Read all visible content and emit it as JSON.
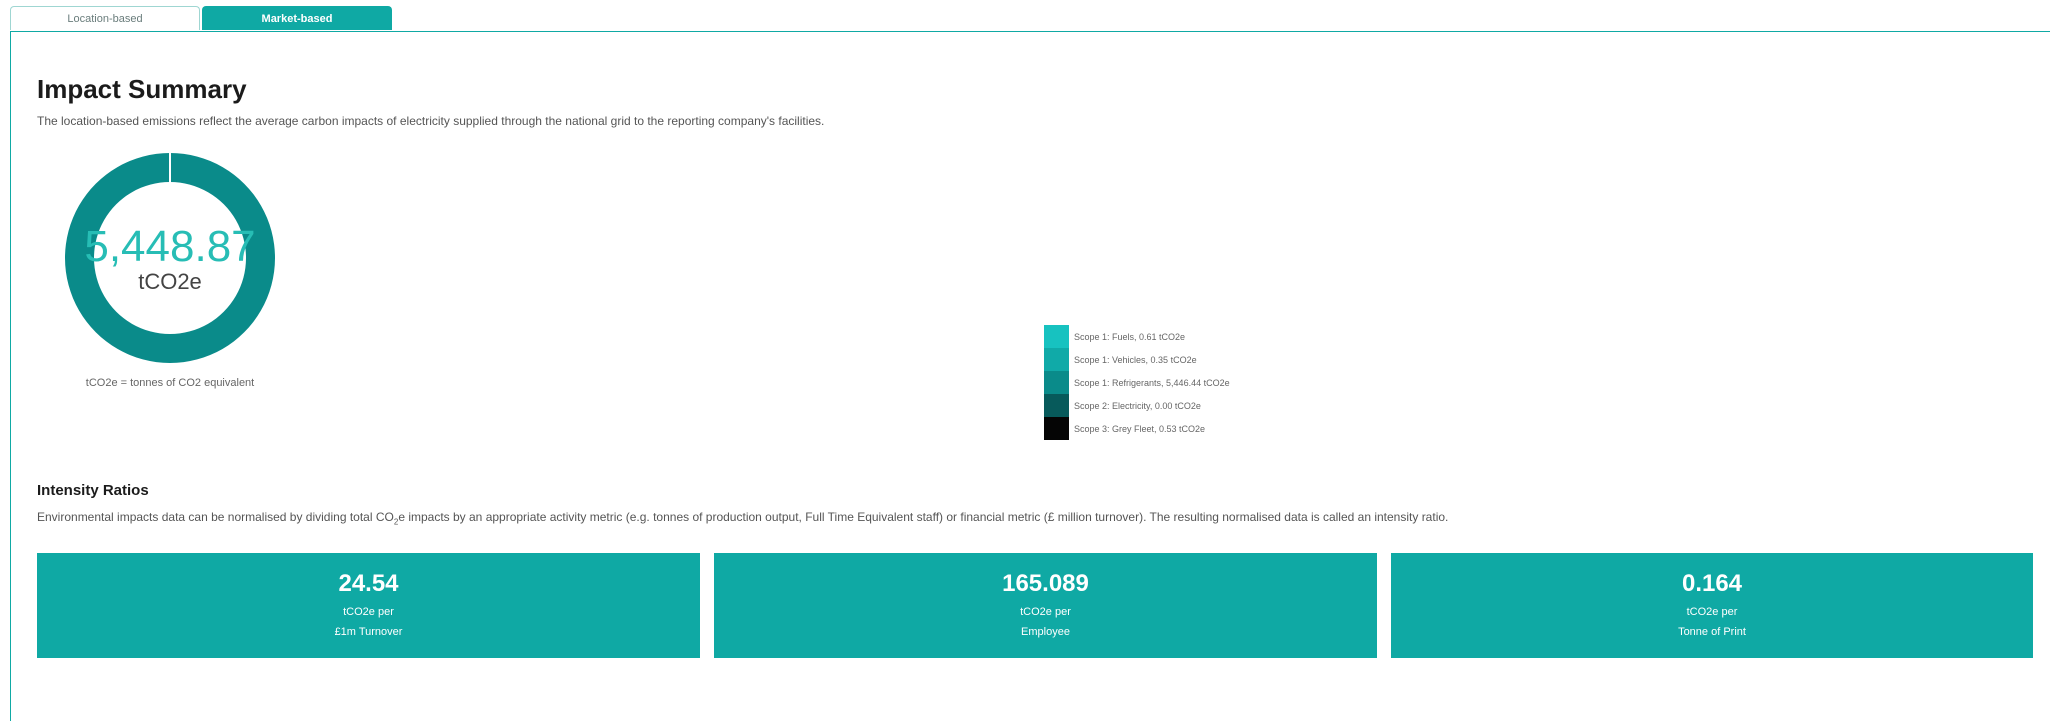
{
  "tabs": [
    {
      "label": "Location-based",
      "active": false
    },
    {
      "label": "Market-based",
      "active": true
    }
  ],
  "summary": {
    "title": "Impact Summary",
    "description": "The location-based emissions reflect the average carbon impacts of electricity supplied through the national grid to the reporting company's facilities.",
    "total_value": "5,448.87",
    "total_unit": "tCO2e",
    "unit_note": "tCO2e = tonnes of CO2 equivalent"
  },
  "chart_data": {
    "type": "pie",
    "categories": [
      "Scope 1: Fuels",
      "Scope 1: Vehicles",
      "Scope 1: Refrigerants",
      "Scope 2: Electricity",
      "Scope 3: Grey Fleet"
    ],
    "values": [
      0.61,
      0.35,
      5446.44,
      0.0,
      0.53
    ],
    "colors": [
      "#17c2c0",
      "#10aaa8",
      "#0a8b8a",
      "#075a5b",
      "#050505"
    ],
    "legend_labels": [
      "Scope 1: Fuels, 0.61 tCO2e",
      "Scope 1: Vehicles, 0.35 tCO2e",
      "Scope 1: Refrigerants, 5,446.44 tCO2e",
      "Scope 2: Electricity, 0.00 tCO2e",
      "Scope 3: Grey Fleet, 0.53 tCO2e"
    ],
    "legend_position": "right"
  },
  "intensity": {
    "title": "Intensity Ratios",
    "description_pre": "Environmental impacts data can be normalised by dividing total CO",
    "description_sub": "2",
    "description_post": "e impacts by an appropriate activity metric (e.g. tonnes of production output, Full Time Equivalent staff) or financial metric (£ million turnover). The resulting normalised data is called an intensity ratio.",
    "cards": [
      {
        "value": "24.54",
        "line1": "tCO2e per",
        "line2": "£1m Turnover"
      },
      {
        "value": "165.089",
        "line1": "tCO2e per",
        "line2": "Employee"
      },
      {
        "value": "0.164",
        "line1": "tCO2e per",
        "line2": "Tonne of Print"
      }
    ]
  }
}
